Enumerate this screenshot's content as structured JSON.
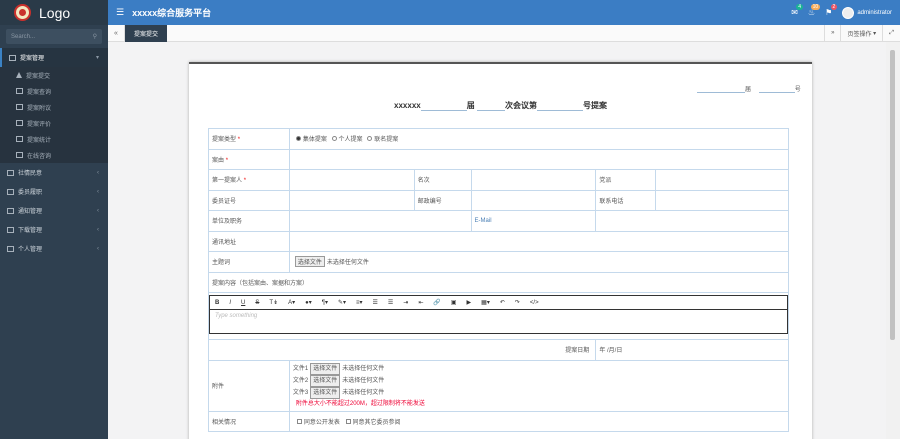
{
  "app": {
    "logo": "Logo",
    "title": "xxxxx综合服务平台",
    "user": "administrator"
  },
  "search": {
    "placeholder": "Search..."
  },
  "top_badges": {
    "mail": "4",
    "bell": "10",
    "flag": "2"
  },
  "sidebar": {
    "items": [
      {
        "label": "提案管理",
        "active": true
      },
      {
        "label": "社情民意"
      },
      {
        "label": "委员履职"
      },
      {
        "label": "通知管理"
      },
      {
        "label": "下载管理"
      },
      {
        "label": "个人管理"
      }
    ],
    "sub": [
      {
        "label": "提案提交"
      },
      {
        "label": "提案查询"
      },
      {
        "label": "提案附议"
      },
      {
        "label": "提案评价"
      },
      {
        "label": "提案统计"
      },
      {
        "label": "在线咨询"
      }
    ]
  },
  "tabs": {
    "active": "提案提交",
    "ops": "页签操作"
  },
  "form": {
    "num_jie": "届",
    "num_hao": "号",
    "title_a": "xxxxxx",
    "title_b": "届",
    "title_c": "次会议第",
    "title_d": "号提案",
    "type_label": "提案类型",
    "type_opts": [
      "集体提案",
      "个人提案",
      "联名提案"
    ],
    "cause_label": "案由",
    "first_label": "第一提案人",
    "rank_label": "名次",
    "party_label": "党派",
    "cert_label": "委员证号",
    "post_label": "邮政编号",
    "phone_label": "联系电话",
    "unit_label": "单位及职务",
    "email_label": "E-Mail",
    "addr_label": "通讯地址",
    "topic_label": "主题词",
    "choose_btn": "选择文件",
    "no_file": "未选择任何文件",
    "content_label": "提案内容（包括案由、案据和方案）",
    "placeholder": "Type something",
    "date_label": "提案日期",
    "date_value": "年 /月/日",
    "attach_label": "附件",
    "files": [
      "文件1",
      "文件2",
      "文件3"
    ],
    "warn": "附件总大小不能超过200M，超过限制将不能发送",
    "related_label": "相关情况",
    "related_opts": [
      "同意公开发表",
      "同意其它委员参阅"
    ]
  }
}
